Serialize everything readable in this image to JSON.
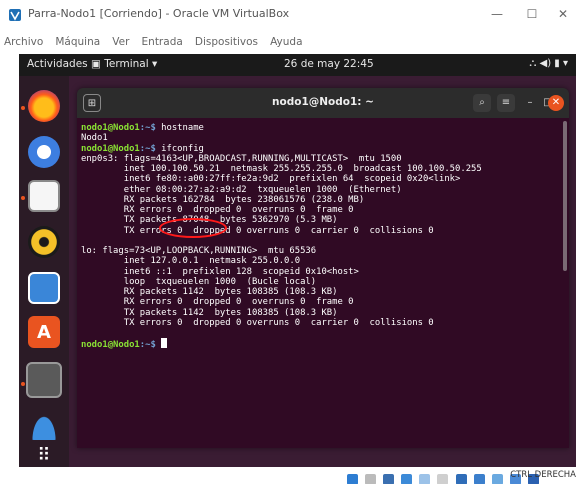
{
  "window": {
    "title": "Parra-Nodo1 [Corriendo] - Oracle VM VirtualBox",
    "minimize_glyph": "—",
    "maximize_glyph": "☐",
    "close_glyph": "✕"
  },
  "menubar": {
    "items": [
      "Archivo",
      "Máquina",
      "Ver",
      "Entrada",
      "Dispositivos",
      "Ayuda"
    ]
  },
  "gnome_topbar": {
    "activities": "Actividades",
    "app_menu": "Terminal ▾",
    "clock": "26 de may  22:45",
    "status": "⛬  ◀)  ▮  ▾"
  },
  "terminal": {
    "title": "nodo1@Nodo1: ~",
    "prompt_user": "nodo1@Nodo1",
    "prompt_path": ":~$ ",
    "lines": [
      {
        "type": "prompt",
        "cmd": "hostname"
      },
      {
        "type": "out",
        "text": "Nodo1"
      },
      {
        "type": "prompt",
        "cmd": "ifconfig"
      },
      {
        "type": "out",
        "text": "enp0s3: flags=4163<UP,BROADCAST,RUNNING,MULTICAST>  mtu 1500"
      },
      {
        "type": "out",
        "text": "        inet 100.100.50.21  netmask 255.255.255.0  broadcast 100.100.50.255"
      },
      {
        "type": "out",
        "text": "        inet6 fe80::a00:27ff:fe2a:9d2  prefixlen 64  scopeid 0x20<link>"
      },
      {
        "type": "out",
        "text": "        ether 08:00:27:a2:a9:d2  txqueuelen 1000  (Ethernet)"
      },
      {
        "type": "out",
        "text": "        RX packets 162784  bytes 238061576 (238.0 MB)"
      },
      {
        "type": "out",
        "text": "        RX errors 0  dropped 0  overruns 0  frame 0"
      },
      {
        "type": "out",
        "text": "        TX packets 87048  bytes 5362970 (5.3 MB)"
      },
      {
        "type": "out",
        "text": "        TX errors 0  dropped 0 overruns 0  carrier 0  collisions 0"
      },
      {
        "type": "out",
        "text": ""
      },
      {
        "type": "out",
        "text": "lo: flags=73<UP,LOOPBACK,RUNNING>  mtu 65536"
      },
      {
        "type": "out",
        "text": "        inet 127.0.0.1  netmask 255.0.0.0"
      },
      {
        "type": "out",
        "text": "        inet6 ::1  prefixlen 128  scopeid 0x10<host>"
      },
      {
        "type": "out",
        "text": "        loop  txqueuelen 1000  (Bucle local)"
      },
      {
        "type": "out",
        "text": "        RX packets 1142  bytes 108385 (108.3 KB)"
      },
      {
        "type": "out",
        "text": "        RX errors 0  dropped 0  overruns 0  frame 0"
      },
      {
        "type": "out",
        "text": "        TX packets 1142  bytes 108385 (108.3 KB)"
      },
      {
        "type": "out",
        "text": "        TX errors 0  dropped 0 overruns 0  carrier 0  collisions 0"
      },
      {
        "type": "out",
        "text": ""
      },
      {
        "type": "prompt",
        "cmd": ""
      }
    ]
  },
  "statusbar": {
    "host_key": "CTRL DERECHA"
  },
  "colors": {
    "terminal_bg": "#300a24",
    "prompt_user": "#8ae234",
    "prompt_path": "#729fcf",
    "highlight": "#ff1a1a",
    "ubuntu_orange": "#e95420"
  }
}
